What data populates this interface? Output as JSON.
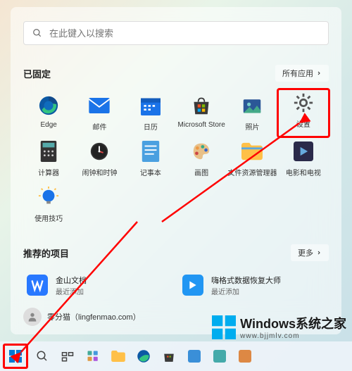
{
  "search": {
    "placeholder": "在此键入以搜索"
  },
  "pinned": {
    "title": "已固定",
    "all_apps_btn": "所有应用",
    "apps": [
      {
        "id": "edge",
        "label": "Edge"
      },
      {
        "id": "mail",
        "label": "邮件"
      },
      {
        "id": "calendar",
        "label": "日历"
      },
      {
        "id": "store",
        "label": "Microsoft Store"
      },
      {
        "id": "photos",
        "label": "照片"
      },
      {
        "id": "settings",
        "label": "设置"
      },
      {
        "id": "calculator",
        "label": "计算器"
      },
      {
        "id": "clock",
        "label": "闹钟和时钟"
      },
      {
        "id": "notepad",
        "label": "记事本"
      },
      {
        "id": "paint",
        "label": "画图"
      },
      {
        "id": "explorer",
        "label": "文件资源管理器"
      },
      {
        "id": "movies",
        "label": "电影和电视"
      },
      {
        "id": "tips",
        "label": "使用技巧"
      }
    ]
  },
  "recommended": {
    "title": "推荐的项目",
    "more_btn": "更多",
    "items": [
      {
        "id": "wps",
        "title": "金山文档",
        "sub": "最近添加"
      },
      {
        "id": "recovery",
        "title": "嗨格式数据恢复大师",
        "sub": "最近添加"
      }
    ]
  },
  "user": {
    "name": "零分猫（lingfenmao.com）"
  },
  "watermark": {
    "title": "Windows系统之家",
    "url": "www.bjjmlv.com"
  }
}
